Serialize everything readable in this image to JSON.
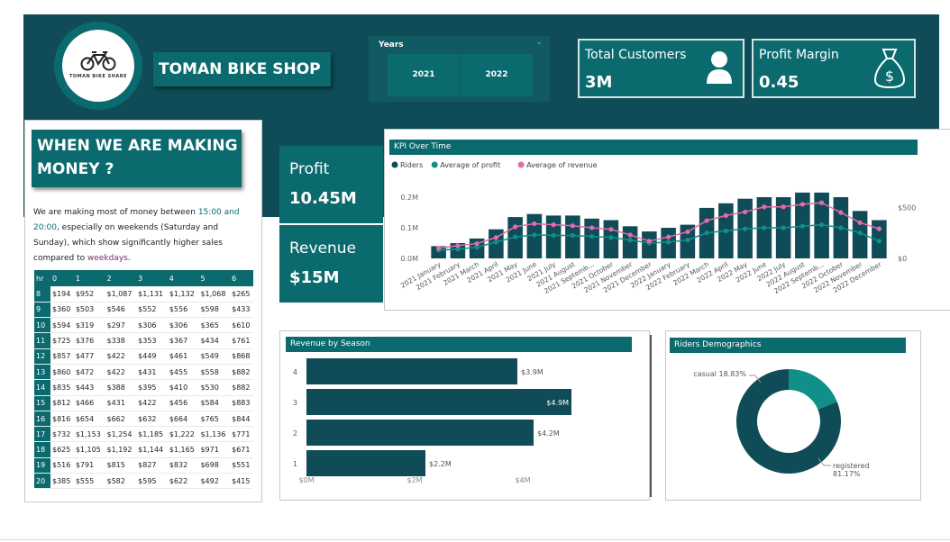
{
  "app": {
    "title": "TOMAN BIKE SHOP",
    "logo_text": "TOMAN BIKE SHARE"
  },
  "years_filter": {
    "label": "Years",
    "options": [
      "2021",
      "2022"
    ]
  },
  "kpis": {
    "total_customers": {
      "label": "Total Customers",
      "value": "3M",
      "icon": "person-icon"
    },
    "profit_margin": {
      "label": "Profit Margin",
      "value": "0.45",
      "icon": "money-bag-icon"
    },
    "profit": {
      "label": "Profit",
      "value": "10.45M"
    },
    "revenue": {
      "label": "Revenue",
      "value": "$15M"
    }
  },
  "insight": {
    "title": "WHEN WE ARE MAKING MONEY ?",
    "p1": "We are making most of money between ",
    "time_range": "15:00 and 20:00",
    "p2": ", especially on weekends (Saturday and Sunday), which show significantly higher sales compared to ",
    "weekdays": "weekdays",
    "p3": "."
  },
  "hour_table": {
    "columns": [
      "hr",
      "0",
      "1",
      "2",
      "3",
      "4",
      "5",
      "6"
    ],
    "rows": [
      [
        "8",
        "$194",
        "$952",
        "$1,087",
        "$1,131",
        "$1,132",
        "$1,068",
        "$265"
      ],
      [
        "9",
        "$360",
        "$503",
        "$546",
        "$552",
        "$556",
        "$598",
        "$433"
      ],
      [
        "10",
        "$594",
        "$319",
        "$297",
        "$306",
        "$306",
        "$365",
        "$610"
      ],
      [
        "11",
        "$725",
        "$376",
        "$338",
        "$353",
        "$367",
        "$434",
        "$761"
      ],
      [
        "12",
        "$857",
        "$477",
        "$422",
        "$449",
        "$461",
        "$549",
        "$868"
      ],
      [
        "13",
        "$860",
        "$472",
        "$422",
        "$431",
        "$455",
        "$558",
        "$882"
      ],
      [
        "14",
        "$835",
        "$443",
        "$388",
        "$395",
        "$410",
        "$530",
        "$882"
      ],
      [
        "15",
        "$812",
        "$466",
        "$431",
        "$422",
        "$456",
        "$584",
        "$883"
      ],
      [
        "16",
        "$816",
        "$654",
        "$662",
        "$632",
        "$664",
        "$765",
        "$844"
      ],
      [
        "17",
        "$732",
        "$1,153",
        "$1,254",
        "$1,185",
        "$1,222",
        "$1,136",
        "$771"
      ],
      [
        "18",
        "$625",
        "$1,105",
        "$1,192",
        "$1,144",
        "$1,165",
        "$971",
        "$671"
      ],
      [
        "19",
        "$516",
        "$791",
        "$815",
        "$827",
        "$832",
        "$698",
        "$551"
      ],
      [
        "20",
        "$385",
        "$555",
        "$582",
        "$595",
        "$622",
        "$492",
        "$415"
      ]
    ]
  },
  "chart_data": [
    {
      "type": "bar",
      "title": "KPI Over Time",
      "legend": [
        "Riders",
        "Average of profit",
        "Average of revenue"
      ],
      "categories": [
        "2021 January",
        "2021 February",
        "2021 March",
        "2021 April",
        "2021 May",
        "2021 June",
        "2021 July",
        "2021 August",
        "2021 Septemb...",
        "2021 October",
        "2021 November",
        "2021 December",
        "2022 January",
        "2022 February",
        "2022 March",
        "2022 April",
        "2022 May",
        "2022 June",
        "2022 July",
        "2022 August",
        "2022 Septemb...",
        "2022 October",
        "2022 November",
        "2022 December"
      ],
      "series": [
        {
          "name": "Riders",
          "axis": "left",
          "values": [
            0.04,
            0.05,
            0.065,
            0.095,
            0.135,
            0.145,
            0.14,
            0.14,
            0.13,
            0.125,
            0.105,
            0.088,
            0.1,
            0.11,
            0.165,
            0.18,
            0.195,
            0.2,
            0.2,
            0.215,
            0.215,
            0.2,
            0.155,
            0.125
          ]
        },
        {
          "name": "Average of profit",
          "axis": "right",
          "values": [
            80,
            90,
            110,
            160,
            210,
            230,
            225,
            225,
            215,
            205,
            180,
            150,
            160,
            180,
            250,
            270,
            290,
            300,
            300,
            315,
            330,
            300,
            250,
            170
          ]
        },
        {
          "name": "Average of revenue",
          "axis": "right",
          "values": [
            100,
            125,
            145,
            205,
            310,
            340,
            330,
            320,
            300,
            285,
            230,
            170,
            210,
            260,
            370,
            420,
            455,
            505,
            505,
            530,
            545,
            450,
            350,
            290
          ]
        }
      ],
      "left_axis": {
        "ticks": [
          "0.0M",
          "0.1M",
          "0.2M"
        ],
        "ylim": [
          0,
          0.25
        ]
      },
      "right_axis": {
        "ticks": [
          "$0",
          "$500"
        ],
        "ylim": [
          0,
          750
        ]
      }
    },
    {
      "type": "bar",
      "orientation": "horizontal",
      "title": "Revenue by Season",
      "categories": [
        "4",
        "3",
        "2",
        "1"
      ],
      "values": [
        3.9,
        4.9,
        4.2,
        2.2
      ],
      "labels": [
        "$3.9M",
        "$4.9M",
        "$4.2M",
        "$2.2M"
      ],
      "x_ticks": [
        "$0M",
        "$2M",
        "$4M"
      ],
      "xlim": [
        0,
        5
      ]
    },
    {
      "type": "pie",
      "title": "Riders Demographics",
      "slices": [
        {
          "name": "casual",
          "value": 18.83,
          "label": "casual 18.83%",
          "color": "#11908a"
        },
        {
          "name": "registered",
          "value": 81.17,
          "label": "registered 81.17%",
          "color": "#0f4c57"
        }
      ]
    }
  ],
  "colors": {
    "banner": "#0f4c57",
    "accent": "#0b6a6e",
    "profit_line": "#11908a",
    "revenue_line": "#e86aa8"
  }
}
